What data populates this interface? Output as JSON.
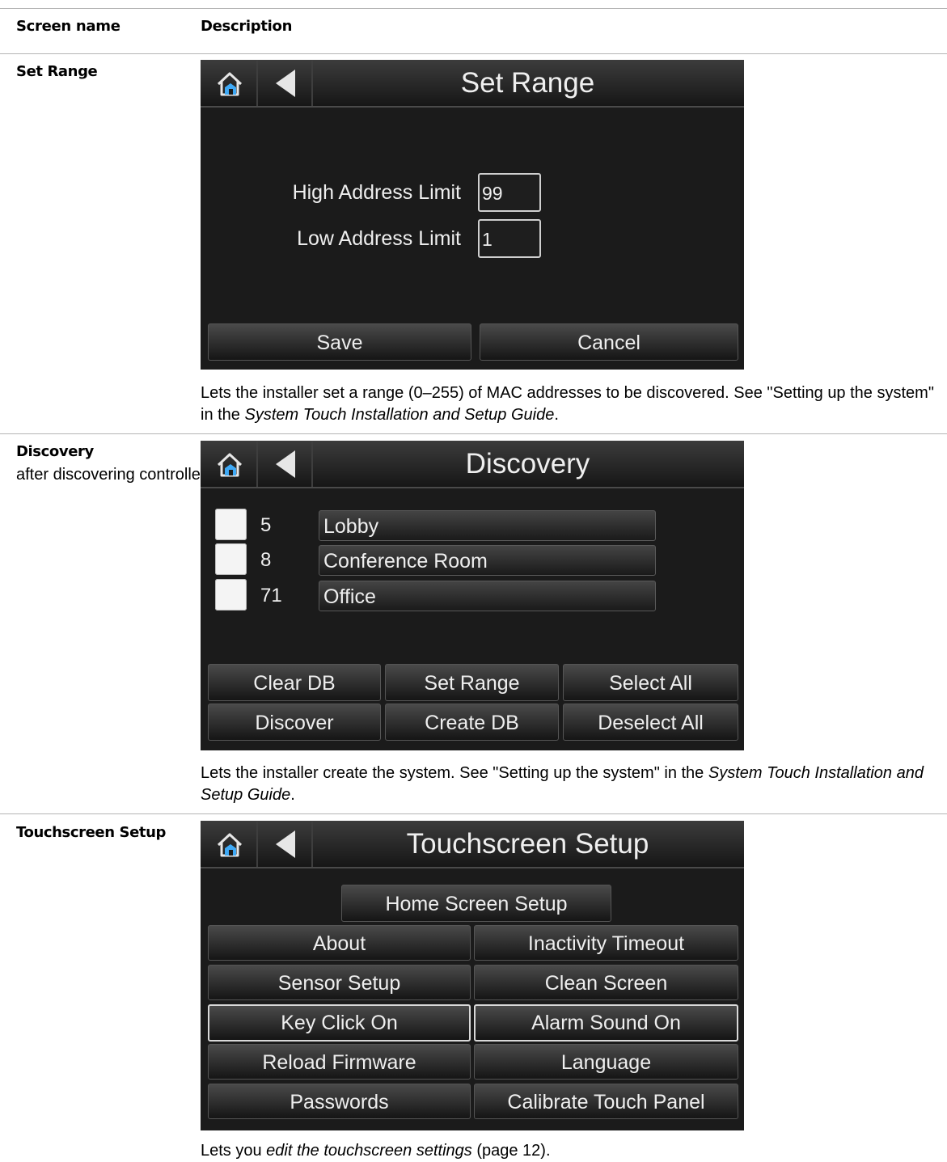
{
  "table": {
    "header_screen": "Screen name",
    "header_description": "Description"
  },
  "rows": [
    {
      "name": "Set Range",
      "screen": {
        "title": "Set Range",
        "high_label": "High Address Limit",
        "high_value": "99",
        "low_label": "Low Address Limit",
        "low_value": "1",
        "save_label": "Save",
        "cancel_label": "Cancel"
      },
      "desc": {
        "part1": "Lets the installer set a range (0–255) of MAC addresses to be discovered. See \"Setting up the system\" in the ",
        "italic": "System Touch Installation and Setup Guide",
        "part2": "."
      }
    },
    {
      "name": "Discovery",
      "subname": "after discovering controllers",
      "screen": {
        "title": "Discovery",
        "items": [
          {
            "num": "5",
            "label": "Lobby"
          },
          {
            "num": "8",
            "label": "Conference Room"
          },
          {
            "num": "71",
            "label": "Office"
          }
        ],
        "buttons": [
          "Clear DB",
          "Set Range",
          "Select All",
          "Discover",
          "Create DB",
          "Deselect All"
        ]
      },
      "desc": {
        "part1": "Lets the installer create the system. See \"Setting up the system\" in the ",
        "italic": "System Touch Installation and Setup Guide",
        "part2": "."
      }
    },
    {
      "name": "Touchscreen Setup",
      "screen": {
        "title": "Touchscreen Setup",
        "home_setup": "Home Screen Setup",
        "buttons": [
          "About",
          "Inactivity Timeout",
          "Sensor Setup",
          "Clean Screen",
          "Key Click On",
          "Alarm Sound On",
          "Reload Firmware",
          "Language",
          "Passwords",
          "Calibrate Touch Panel"
        ]
      },
      "desc": {
        "part1": "Lets you ",
        "italic": "edit the touchscreen settings",
        "part2": " (page 12)."
      }
    }
  ],
  "colors": {
    "screen_bg": "#1b1b1b",
    "button_text": "#eeeeee",
    "home_icon_blue": "#3fa9f5"
  }
}
